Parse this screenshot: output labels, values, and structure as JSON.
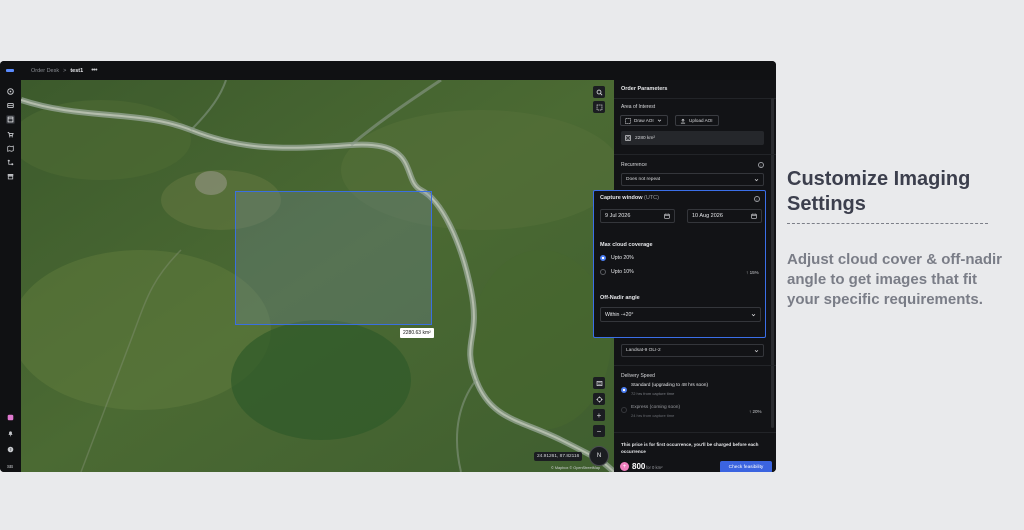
{
  "topbar": {
    "breadcrumb_root": "Order Desk",
    "breadcrumb_sep": ">",
    "breadcrumb_current": "test1",
    "more_menu": "•••"
  },
  "sidenav": {
    "items": [
      "dashboard-icon",
      "catalog-icon",
      "tasking-icon",
      "cart-icon",
      "map-icon",
      "workflow-icon",
      "archive-icon"
    ],
    "bottom": [
      "apps-icon",
      "notifications-icon",
      "help-icon"
    ],
    "avatar": "SB"
  },
  "map": {
    "aoi_area_label": "2280.63 km²",
    "coordinates": "24.91261, 87.82116",
    "compass_label": "N",
    "attribution": "© Mapbox © OpenStreetMap",
    "zoom_in": "+",
    "zoom_out": "−"
  },
  "panel": {
    "title": "Order Parameters",
    "area_of_interest_label": "Area of Interest",
    "draw_aoi_label": "Draw AOI",
    "upload_aoi_label": "Upload AOI",
    "aoi_area": "2280 km²",
    "recurrence_label": "Recurrence",
    "recurrence_value": "Does not repeat",
    "capture_window_label": "Capture window",
    "capture_window_unit": "(UTC)",
    "start_date": "9 Jul 2026",
    "end_date": "10 Aug 2026",
    "cloud_label": "Max cloud coverage",
    "cloud_options": [
      {
        "label": "Upto 20%",
        "selected": true,
        "note": ""
      },
      {
        "label": "Upto 10%",
        "selected": false,
        "note": "↑ 15%"
      }
    ],
    "off_nadir_label": "Off-Nadir angle",
    "off_nadir_value": "Within -+20°",
    "sensor_value": "Landsat-9 OLI-2",
    "delivery_label": "Delivery Speed",
    "delivery_options": [
      {
        "label": "Standard (upgrading to 48 hrs soon)",
        "sub": "72 hrs from capture time",
        "selected": true,
        "note": ""
      },
      {
        "label": "Express (coming soon)",
        "sub": "24 hrs from capture time",
        "selected": false,
        "note": "↑ 20%"
      }
    ],
    "price_note": "This price is for first occurrence, you'll be charged before each occurrence",
    "price": "800",
    "price_sub": "for 0 km²",
    "check_button": "Check feasibility"
  },
  "callout": {
    "title_line1": "Customize Imaging",
    "title_line2": "Settings",
    "body": "Adjust cloud cover & off-nadir angle to get images that fit your specific requirements."
  },
  "colors": {
    "accent": "#3b6fe8",
    "panel_bg": "#121316",
    "callout_title": "#3c3f4d",
    "callout_body": "#7a7d87"
  }
}
